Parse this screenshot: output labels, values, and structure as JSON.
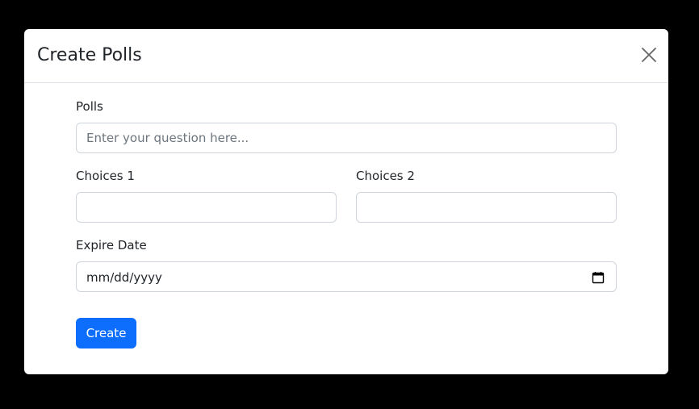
{
  "modal": {
    "title": "Create Polls",
    "close_icon": "close-icon"
  },
  "form": {
    "polls_label": "Polls",
    "polls_placeholder": "Enter your question here...",
    "polls_value": "",
    "choice1_label": "Choices 1",
    "choice1_value": "",
    "choice2_label": "Choices 2",
    "choice2_value": "",
    "expire_label": "Expire Date",
    "expire_value": "mm/dd/yyyy",
    "calendar_icon": "calendar-icon",
    "submit_label": "Create"
  },
  "colors": {
    "backdrop": "#000000",
    "primary": "#0d6efd",
    "border": "#ced4da"
  }
}
